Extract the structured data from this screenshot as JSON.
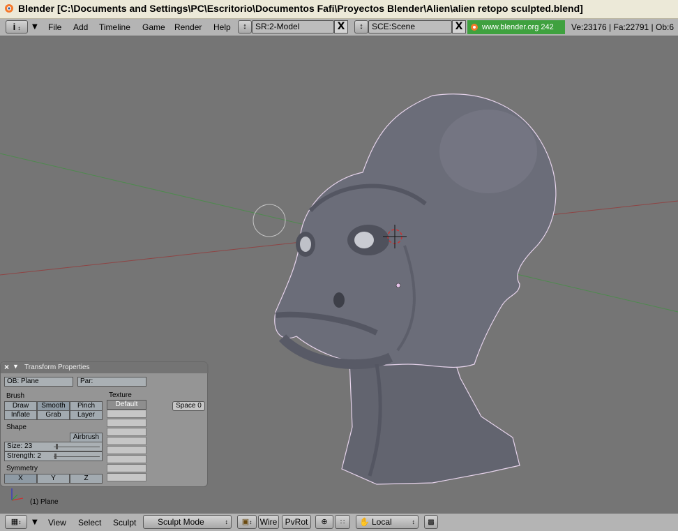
{
  "window": {
    "title": "Blender [C:\\Documents and Settings\\PC\\Escritorio\\Documentos Fafi\\Proyectos Blender\\Alien\\alien retopo sculpted.blend]"
  },
  "menubar": {
    "info_icon": "i",
    "menus": [
      "File",
      "Add",
      "Timeline",
      "Game",
      "Render",
      "Help"
    ],
    "screen_field": "SR:2-Model",
    "scene_field": "SCE:Scene",
    "close_glyph": "X",
    "url": "www.blender.org 242",
    "stats": "Ve:23176 | Fa:22791 | Ob:6"
  },
  "panel": {
    "title": "Transform Properties",
    "ob_field": "OB: Plane",
    "par_field": "Par:",
    "brush_label": "Brush",
    "brushes": [
      "Draw",
      "Smooth",
      "Pinch",
      "Inflate",
      "Grab",
      "Layer"
    ],
    "active_brush": "Smooth",
    "shape_label": "Shape",
    "airbrush": "Airbrush",
    "size": "Size: 23",
    "size_value": 23,
    "strength": "Strength: 2",
    "strength_value": 2,
    "symmetry_label": "Symmetry",
    "symmetry": [
      "X",
      "Y",
      "Z"
    ],
    "texture_label": "Texture",
    "texture_default": "Default",
    "space_button": "Space 0"
  },
  "viewport": {
    "object_label": "(1) Plane"
  },
  "bottombar": {
    "menus": [
      "View",
      "Select",
      "Sculpt"
    ],
    "mode": "Sculpt Mode",
    "wire": "Wire",
    "pvrot": "PvRot",
    "orientation": "Local"
  },
  "colors": {
    "viewport_bg": "#757575",
    "header_bg": "#b4b4b4",
    "url_bg": "#3fa13f",
    "mesh": "#6a6c78"
  }
}
